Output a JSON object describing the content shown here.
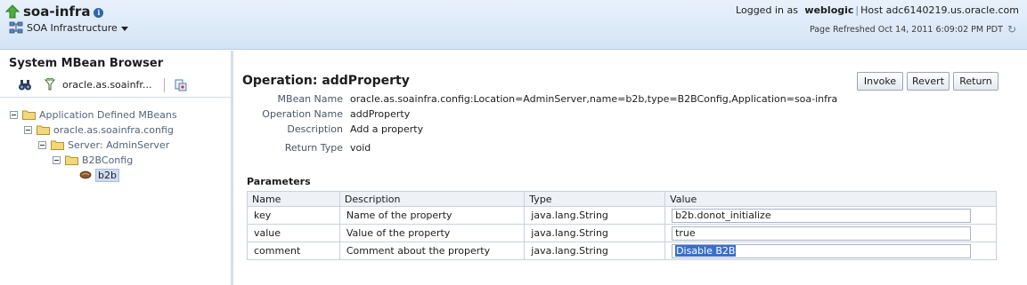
{
  "header": {
    "app_title": "soa-infra",
    "nav_label": "SOA Infrastructure",
    "logged_in_as": "Logged in as",
    "username": "weblogic",
    "host_sep": "|",
    "host_label": "Host adc6140219.us.oracle.com",
    "page_refreshed": "Page Refreshed Oct 14, 2011 6:09:02 PM PDT"
  },
  "left_panel": {
    "title": "System MBean Browser",
    "toolbar_label": "oracle.as.soainfr...",
    "tree": [
      {
        "label": "Application Defined MBeans",
        "type": "folder",
        "expanded": true
      },
      {
        "label": "oracle.as.soainfra.config",
        "type": "folder",
        "expanded": true
      },
      {
        "label": "Server: AdminServer",
        "type": "folder",
        "expanded": true
      },
      {
        "label": "B2BConfig",
        "type": "folder",
        "expanded": true
      },
      {
        "label": "b2b",
        "type": "bean",
        "selected": true
      }
    ]
  },
  "operation": {
    "title": "Operation: addProperty",
    "buttons": {
      "invoke": "Invoke",
      "revert": "Revert",
      "return": "Return"
    },
    "properties": [
      {
        "label": "MBean Name",
        "value": "oracle.as.soainfra.config:Location=AdminServer,name=b2b,type=B2BConfig,Application=soa-infra"
      },
      {
        "label": "Operation Name",
        "value": "addProperty"
      },
      {
        "label": "Description",
        "value": "Add a property"
      },
      {
        "label": "Return Type",
        "value": "void"
      }
    ]
  },
  "parameters": {
    "title": "Parameters",
    "columns": [
      "Name",
      "Description",
      "Type",
      "Value"
    ],
    "rows": [
      {
        "name": "key",
        "description": "Name of the property",
        "type": "java.lang.String",
        "value": "b2b.donot_initialize"
      },
      {
        "name": "value",
        "description": "Value of the property",
        "type": "java.lang.String",
        "value": "true"
      },
      {
        "name": "comment",
        "description": "Comment about the property",
        "type": "java.lang.String",
        "value": "Disable B2B"
      }
    ]
  },
  "colors": {
    "header_bg": "#d4e4f5",
    "selection": "#3b6fc9",
    "folder": "#e8c96a"
  },
  "icons": [
    "home-arrow-icon",
    "info-icon",
    "soa-infrastructure-icon",
    "chevron-down-icon",
    "refresh-icon",
    "binoculars-icon",
    "filter-icon",
    "mbean-action-icon",
    "folder-icon",
    "bean-icon"
  ]
}
